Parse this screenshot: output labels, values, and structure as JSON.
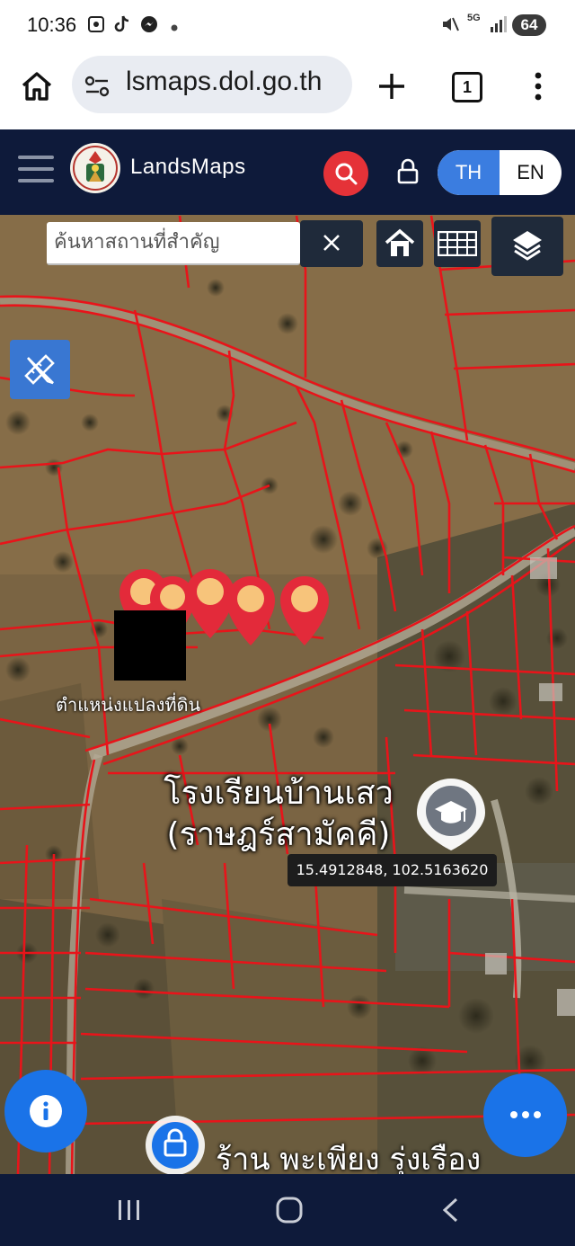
{
  "status_bar": {
    "time": "10:36",
    "battery": "64",
    "network": "5G"
  },
  "browser": {
    "url": "lsmaps.dol.go.th",
    "tab_count": "1"
  },
  "header": {
    "brand": "LandsMaps",
    "lang_th": "TH",
    "lang_en": "EN"
  },
  "map": {
    "search_placeholder": "ค้นหาสถานที่สำคัญ",
    "parcel_label": "ตำแหน่งแปลงที่ดิน",
    "school_label_line1": "โรงเรียนบ้านเสว",
    "school_label_line2": "(ราษฎร์สามัคคี)",
    "shop_label": "ร้าน พะเพียง รุ่งเรือง",
    "coordinates": "15.4912848, 102.5163620"
  },
  "colors": {
    "appbar": "#0e1a3a",
    "accent": "#3b7de0",
    "fab": "#1a73e8",
    "parcel_line": "#e8141a",
    "marker": "#e32a3a",
    "search_btn": "#e53238"
  }
}
